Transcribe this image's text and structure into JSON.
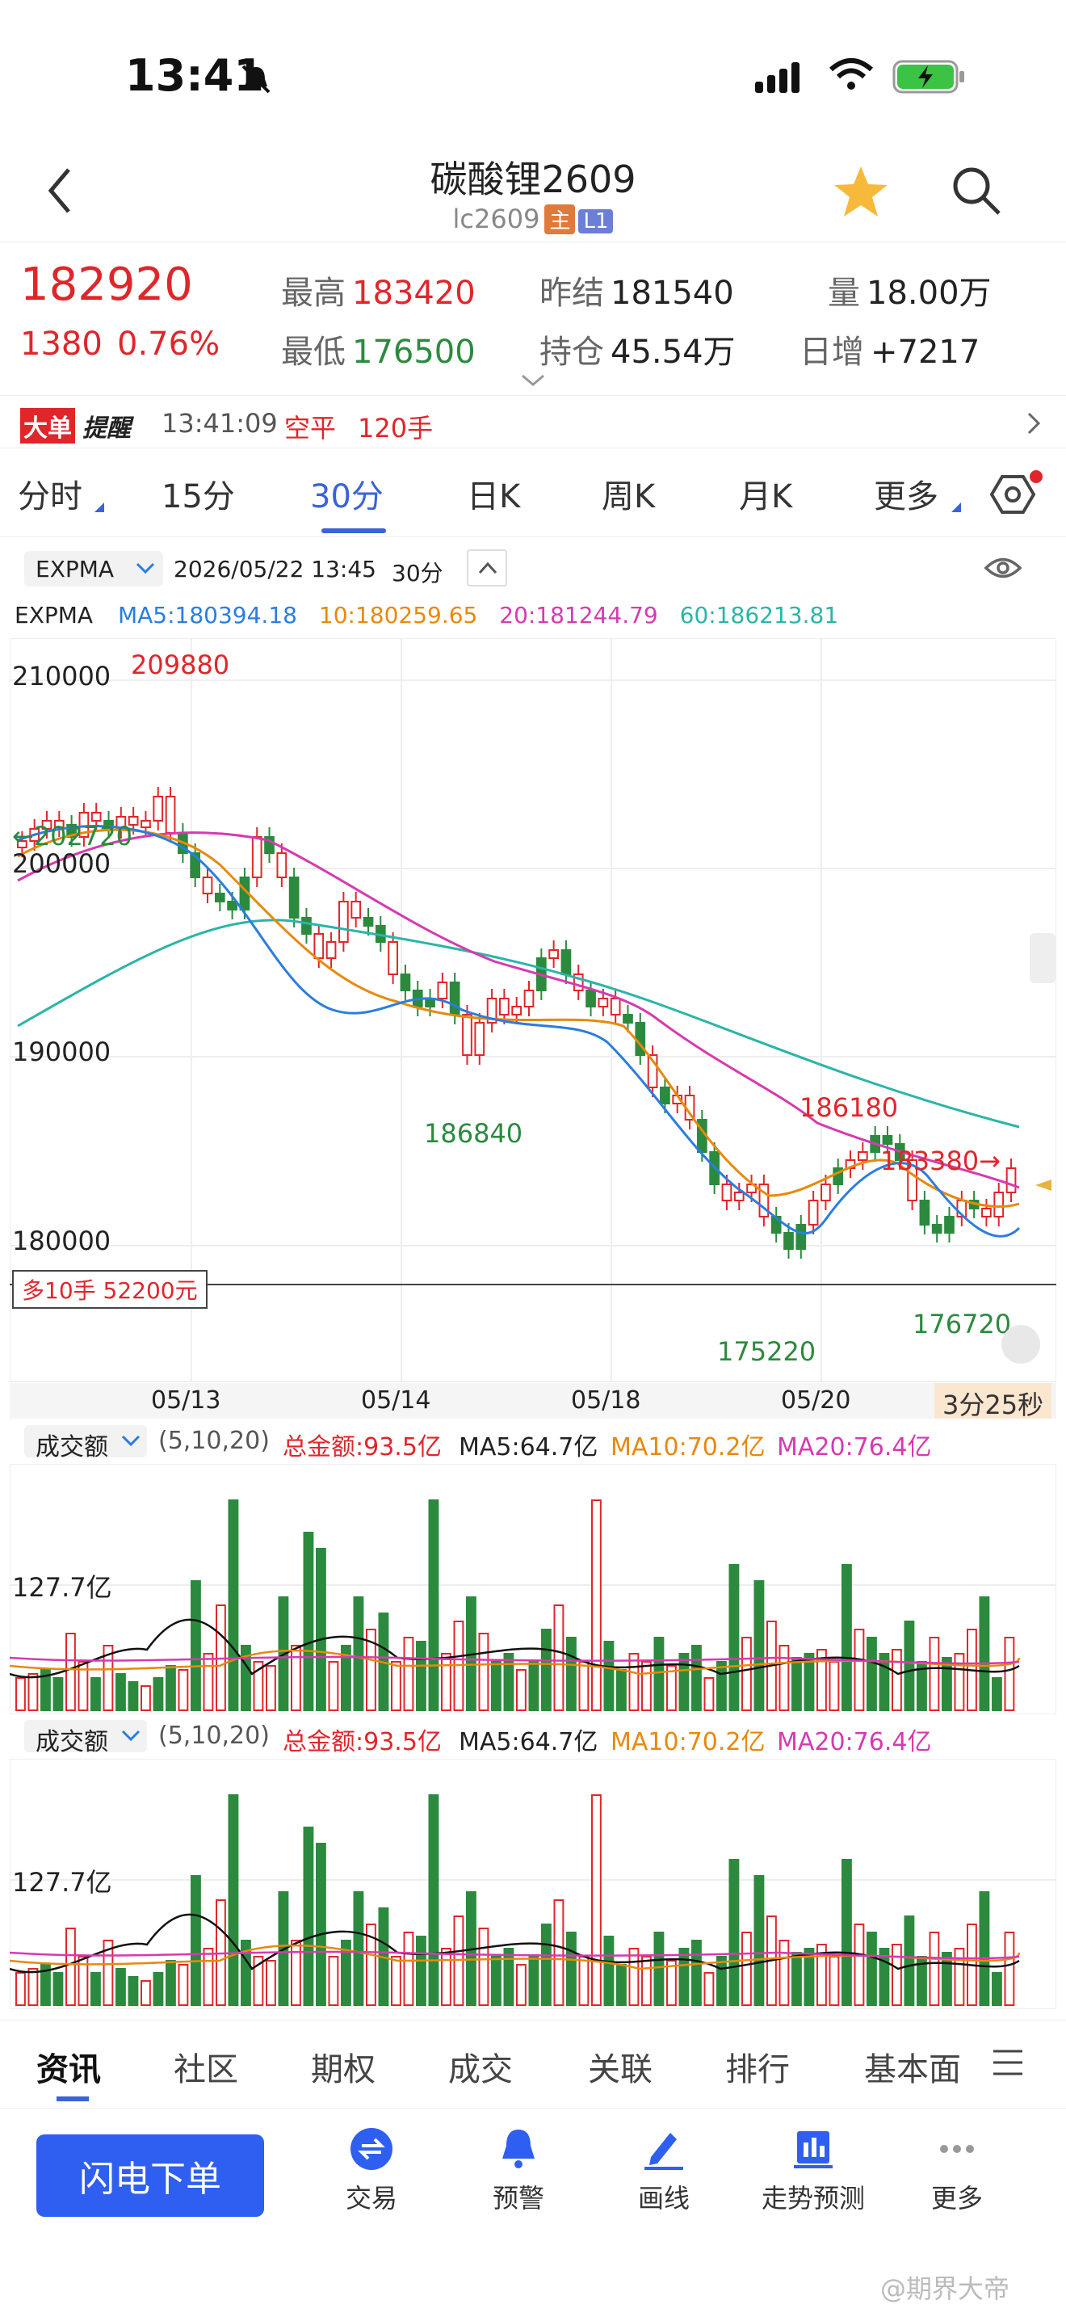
{
  "status": {
    "time": "13:41"
  },
  "nav": {
    "title": "碳酸锂2609",
    "code": "lc2609",
    "tag_main": "主",
    "tag_l1": "L1"
  },
  "quote": {
    "price": "182920",
    "change": "1380",
    "change_pct": "0.76%",
    "high_label": "最高",
    "high": "183420",
    "low_label": "最低",
    "low": "176500",
    "prev_label": "昨结",
    "prev": "181540",
    "oi_label": "持仓",
    "oi": "45.54万",
    "vol_label": "量",
    "vol": "18.00万",
    "daily_label": "日增",
    "daily": "+7217"
  },
  "alert": {
    "badge1": "大单",
    "badge2": "提醒",
    "time": "13:41:09",
    "type": "空平",
    "lots": "120手"
  },
  "tabs": [
    "分时",
    "15分",
    "30分",
    "日K",
    "周K",
    "月K",
    "更多"
  ],
  "active_tab": "30分",
  "chart_header": {
    "indicator": "EXPMA",
    "datetime": "2026/05/22 13:45",
    "period": "30分"
  },
  "indicator_line": {
    "name": "EXPMA",
    "ma5": "MA5:180394.18",
    "ma10": "10:180259.65",
    "ma20": "20:181244.79",
    "ma60": "60:186213.81"
  },
  "price_labels": {
    "y210000": "210000",
    "y200000": "200000",
    "y190000": "190000",
    "y180000": "180000",
    "high_mark": "209880",
    "left_mark": "←202720",
    "low1": "186840",
    "low2": "175220",
    "high2": "186180",
    "cur": "183380→",
    "low3": "176720",
    "position_box": "多10手 52200元"
  },
  "date_labels": [
    "05/13",
    "05/14",
    "05/18",
    "05/20"
  ],
  "countdown": "3分25秒",
  "volume_panels": [
    {
      "name": "成交额",
      "params": "(5,10,20)",
      "total": "总金额:93.5亿",
      "ma5": "MA5:64.7亿",
      "ma10": "MA10:70.2亿",
      "ma20": "MA20:76.4亿",
      "level": "127.7亿"
    },
    {
      "name": "成交额",
      "params": "(5,10,20)",
      "total": "总金额:93.5亿",
      "ma5": "MA5:64.7亿",
      "ma10": "MA10:70.2亿",
      "ma20": "MA20:76.4亿",
      "level": "127.7亿"
    }
  ],
  "bottom_tabs": [
    "资讯",
    "社区",
    "期权",
    "成交",
    "关联",
    "排行",
    "基本面"
  ],
  "toolbar": {
    "flash": "闪电下单",
    "items": [
      "交易",
      "预警",
      "画线",
      "走势预测",
      "更多"
    ]
  },
  "watermark": "@期界大帝",
  "colors": {
    "up": "#e0262b",
    "down": "#2b8a3e",
    "ma5": "#2b7de0",
    "ma10": "#e8890c",
    "ma20": "#d63ab0",
    "ma60": "#2ab5a8",
    "accent": "#3a63d6"
  }
}
